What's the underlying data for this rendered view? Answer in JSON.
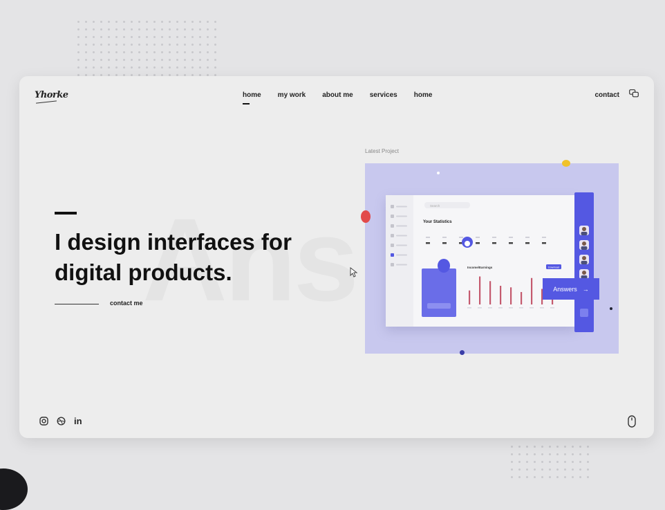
{
  "brand": {
    "logo_text": "Yhorke"
  },
  "nav": {
    "items": [
      "home",
      "my work",
      "about me",
      "services",
      "home"
    ],
    "contact": "contact"
  },
  "hero": {
    "headline_line1": "I design interfaces for",
    "headline_line2": "digital products.",
    "cta": "contact me",
    "ghost_text": "Ans"
  },
  "project": {
    "label": "Latest Project",
    "button_label": "Answers",
    "button_arrow": "→",
    "mockup": {
      "title": "Your Statistics",
      "search_placeholder": "Search",
      "chart_title": "Income/Earnings",
      "chart_button": "Download",
      "bar_levels": [
        0.45,
        0.9,
        0.75,
        0.6,
        0.55,
        0.4,
        0.85,
        0.5,
        0.7
      ],
      "nav_icon_count": 7,
      "avatar_count": 5
    }
  },
  "social": {
    "linkedin": "in"
  },
  "colors": {
    "accent": "#5458e2",
    "preview_bg": "#c8c8ee",
    "card_bg": "#ededed",
    "page_bg": "#e4e4e6",
    "red_dot": "#e24a4a",
    "yellow_dot": "#f0c22a"
  },
  "icons": {
    "chat": "chat-bubbles-icon",
    "instagram": "instagram-icon",
    "dribbble": "dribbble-icon",
    "linkedin": "linkedin-icon",
    "scroll": "mouse-scroll-icon",
    "cursor": "mouse-pointer-icon",
    "arrow": "arrow-right-icon"
  }
}
